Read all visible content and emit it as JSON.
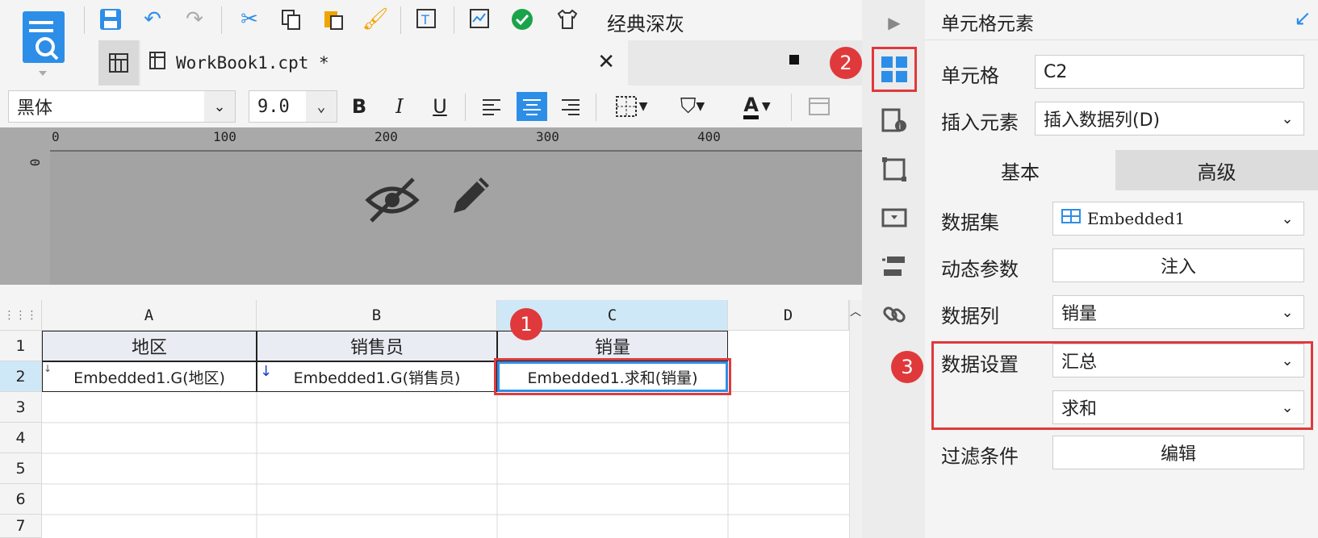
{
  "toolbar": {
    "theme_label": "经典深灰",
    "icons": [
      "save-icon",
      "undo-icon",
      "redo-icon",
      "cut-icon",
      "copy-icon",
      "paste-icon",
      "format-painter-icon",
      "text-icon",
      "preview-icon",
      "check-icon",
      "shirt-icon"
    ]
  },
  "tab": {
    "filename": "WorkBook1.cpt *"
  },
  "format": {
    "font_name": "黑体",
    "font_size": "9.0",
    "bold": "B",
    "italic": "I",
    "underline": "U",
    "font_color_glyph": "A"
  },
  "ruler": {
    "marks": [
      "0",
      "100",
      "200",
      "300",
      "400"
    ],
    "left_mark": "0"
  },
  "sheet": {
    "columns": [
      "A",
      "B",
      "C",
      "D"
    ],
    "rows": [
      "1",
      "2",
      "3",
      "4",
      "5",
      "6",
      "7"
    ],
    "header_cells": [
      "地区",
      "销售员",
      "销量"
    ],
    "data_cells": [
      "Embedded1.G(地区)",
      "Embedded1.G(销售员)",
      "Embedded1.求和(销量)"
    ]
  },
  "panel": {
    "title": "单元格元素",
    "cell_label": "单元格",
    "cell_value": "C2",
    "insert_label": "插入元素",
    "insert_value": "插入数据列(D)",
    "tabs": [
      "基本",
      "高级"
    ],
    "dataset_label": "数据集",
    "dataset_value": "Embedded1",
    "dynparam_label": "动态参数",
    "dynparam_button": "注入",
    "datacol_label": "数据列",
    "datacol_value": "销量",
    "datasetting_label": "数据设置",
    "datasetting_value": "汇总",
    "agg_value": "求和",
    "filter_label": "过滤条件",
    "filter_button": "编辑"
  },
  "badges": [
    "1",
    "2",
    "3"
  ],
  "colors": {
    "accent": "#2d8ee8",
    "highlight_red": "#e0393b",
    "selected_col": "#cfe8f7"
  }
}
